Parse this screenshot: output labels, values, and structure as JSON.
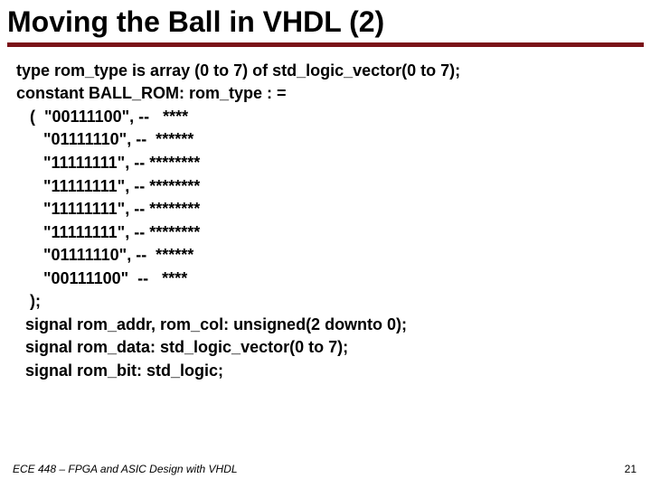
{
  "title": "Moving the Ball in VHDL (2)",
  "code": [
    "type rom_type is array (0 to 7) of std_logic_vector(0 to 7);",
    "constant BALL_ROM: rom_type : =",
    "   (  \"00111100\", --   ****",
    "      \"01111110\", --  ******",
    "      \"11111111\", -- ********",
    "      \"11111111\", -- ********",
    "      \"11111111\", -- ********",
    "      \"11111111\", -- ********",
    "      \"01111110\", --  ******",
    "      \"00111100\"  --   ****",
    "   );",
    "  signal rom_addr, rom_col: unsigned(2 downto 0);",
    "  signal rom_data: std_logic_vector(0 to 7);",
    "  signal rom_bit: std_logic;"
  ],
  "footer": "ECE 448 – FPGA and ASIC Design with VHDL",
  "page": "21",
  "colors": {
    "accent": "#7a1218"
  }
}
